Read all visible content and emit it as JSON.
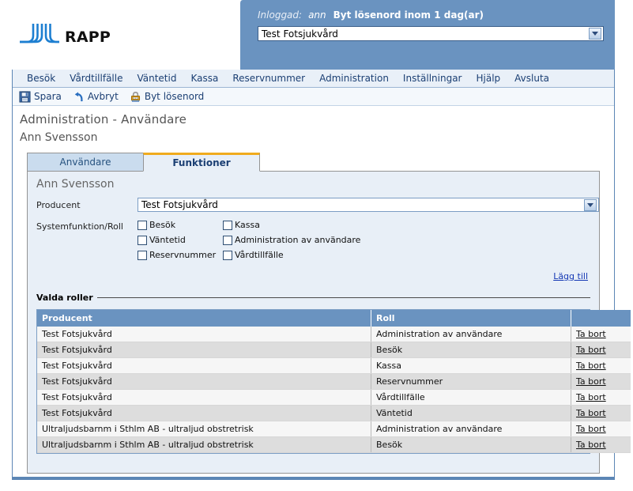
{
  "brand": {
    "logo_text": "RAPP",
    "logo_icon": "jl-monogram-icon",
    "logo_color": "#1d7fd1"
  },
  "login_panel": {
    "logged_in_label": "Inloggad:",
    "username": "ann",
    "password_warning": "Byt lösenord inom 1 dag(ar)",
    "producer_select_value": "Test Fotsjukvård",
    "dropdown_icon": "chevron-down-icon"
  },
  "menu": {
    "items": [
      {
        "label": "Besök"
      },
      {
        "label": "Vårdtillfälle"
      },
      {
        "label": "Väntetid"
      },
      {
        "label": "Kassa"
      },
      {
        "label": "Reservnummer"
      },
      {
        "label": "Administration"
      },
      {
        "label": "Inställningar"
      },
      {
        "label": "Hjälp"
      },
      {
        "label": "Avsluta"
      }
    ]
  },
  "toolbar": {
    "items": [
      {
        "label": "Spara",
        "icon": "save-floppy-icon"
      },
      {
        "label": "Avbryt",
        "icon": "undo-arrow-icon"
      },
      {
        "label": "Byt lösenord",
        "icon": "lock-icon"
      }
    ]
  },
  "page": {
    "title": "Administration - Användare",
    "subject_name": "Ann Svensson"
  },
  "tabs": [
    {
      "label": "Användare",
      "active": false
    },
    {
      "label": "Funktioner",
      "active": true
    }
  ],
  "panel": {
    "heading": "Ann Svensson",
    "producer_label": "Producent",
    "producer_value": "Test Fotsjukvård",
    "roles_label": "Systemfunktion/Roll",
    "checkboxes": [
      {
        "label": "Besök",
        "checked": false
      },
      {
        "label": "Kassa",
        "checked": false
      },
      {
        "label": "Väntetid",
        "checked": false
      },
      {
        "label": "Administration av användare",
        "checked": false
      },
      {
        "label": "Reservnummer",
        "checked": false
      },
      {
        "label": "Vårdtillfälle",
        "checked": false
      }
    ],
    "add_link": "Lägg till"
  },
  "roles_section": {
    "legend": "Valda roller",
    "columns": [
      "Producent",
      "Roll",
      ""
    ],
    "delete_label": "Ta bort",
    "rows": [
      {
        "producent": "Test Fotsjukvård",
        "roll": "Administration av användare"
      },
      {
        "producent": "Test Fotsjukvård",
        "roll": "Besök"
      },
      {
        "producent": "Test Fotsjukvård",
        "roll": "Kassa"
      },
      {
        "producent": "Test Fotsjukvård",
        "roll": "Reservnummer"
      },
      {
        "producent": "Test Fotsjukvård",
        "roll": "Vårdtillfälle"
      },
      {
        "producent": "Test Fotsjukvård",
        "roll": "Väntetid"
      },
      {
        "producent": "Ultraljudsbarnm i Sthlm AB - ultraljud obstretrisk",
        "roll": "Administration av användare"
      },
      {
        "producent": "Ultraljudsbarnm i Sthlm AB - ultraljud obstretrisk",
        "roll": "Besök"
      }
    ]
  },
  "colors": {
    "header_blue": "#6a93c0",
    "menu_bg": "#e9f0f8",
    "panel_bg": "#e8eff7",
    "tab_active_accent": "#f0ab1d",
    "link_blue": "#1438b4"
  }
}
